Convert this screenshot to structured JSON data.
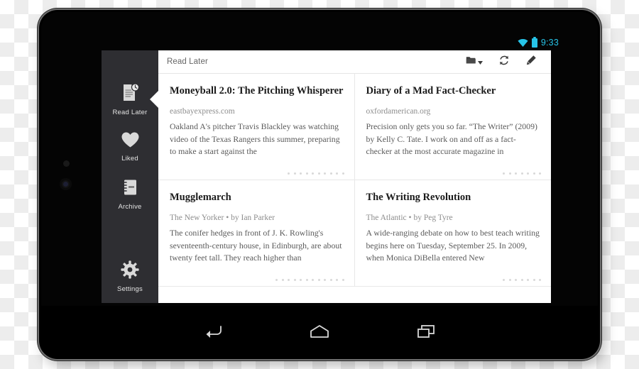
{
  "device": {
    "type": "android-tablet",
    "frame_color": "#000000",
    "bezel_highlight": "#6f6f6f"
  },
  "statusbar": {
    "wifi_icon": "wifi-icon",
    "battery_icon": "battery-icon",
    "clock": "9:33",
    "accent_color": "#27c4e8"
  },
  "sidebar": {
    "background": "#2e2e32",
    "active_index": 0,
    "items": [
      {
        "label": "Read Later",
        "icon": "document-clock-icon"
      },
      {
        "label": "Liked",
        "icon": "heart-icon"
      },
      {
        "label": "Archive",
        "icon": "notebook-icon"
      },
      {
        "label": "Settings",
        "icon": "gear-icon"
      }
    ]
  },
  "appbar": {
    "title": "Read Later",
    "actions": [
      {
        "name": "folder-dropdown",
        "icon": "folder-icon"
      },
      {
        "name": "sync",
        "icon": "refresh-icon"
      },
      {
        "name": "compose",
        "icon": "pencil-icon"
      }
    ]
  },
  "articles": [
    {
      "title": "Moneyball 2.0: The Pitching Whisperer",
      "source": "eastbayexpress.com",
      "excerpt": "Oakland A's pitcher Travis Blackley was watching video of the Texas Rangers this summer, preparing to make a start against the",
      "dots": 10
    },
    {
      "title": "Diary of a Mad Fact-Checker",
      "source": "oxfordamerican.org",
      "excerpt": "Precision only gets you so far. “The Writer” (2009) by Kelly C. Tate. I work on and off as a fact-checker at the most accurate magazine in",
      "dots": 7
    },
    {
      "title": "Mugglemarch",
      "source": "The New Yorker • by Ian Parker",
      "excerpt": "The conifer hedges in front of J. K. Rowling's seventeenth-century house, in Edinburgh, are about twenty feet tall. They reach higher than",
      "dots": 12
    },
    {
      "title": "The Writing Revolution",
      "source": "The Atlantic • by Peg Tyre",
      "excerpt": "A wide-ranging debate on how to best teach writing begins here on Tuesday, September 25. In 2009, when Monica DiBella entered New",
      "dots": 7
    }
  ],
  "navbar": {
    "buttons": [
      {
        "name": "back-button",
        "icon": "back-arrow-icon"
      },
      {
        "name": "home-button",
        "icon": "home-icon"
      },
      {
        "name": "recents-button",
        "icon": "recent-apps-icon"
      }
    ]
  }
}
